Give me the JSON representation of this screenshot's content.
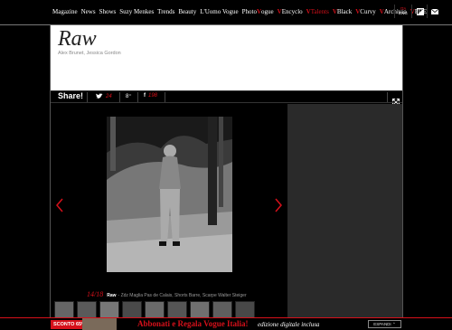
{
  "nav": {
    "items": [
      {
        "text": "Magazine",
        "prefix": ""
      },
      {
        "text": "News",
        "prefix": ""
      },
      {
        "text": "Shows",
        "prefix": ""
      },
      {
        "text": "Suzy Menkes",
        "prefix": ""
      },
      {
        "text": "Trends",
        "prefix": ""
      },
      {
        "text": "Beauty",
        "prefix": ""
      },
      {
        "text": "L'Uomo Vogue",
        "prefix": ""
      },
      {
        "text": "Photo",
        "prefix": "",
        "suffix": "ogue"
      },
      {
        "text": "Encyclo",
        "prefix": "V"
      },
      {
        "text": "Talents",
        "prefix": "V"
      },
      {
        "text": "Black",
        "prefix": "V"
      },
      {
        "text": "Curvy",
        "prefix": "V"
      },
      {
        "text": "Archivio",
        "prefix": "V"
      },
      {
        "text": "FDE",
        "prefix": "V"
      }
    ],
    "lang_active": "ITA",
    "lang_other": "ENG",
    "icons": [
      "contrast-icon",
      "mail-icon"
    ]
  },
  "header": {
    "title": "Raw",
    "credits": "Alex Brunet, Jessica Gordon"
  },
  "share": {
    "label": "Share!",
    "twitter_count": "24",
    "gplus_label": "8⁺",
    "facebook_count": "198"
  },
  "gallery": {
    "counter": "14/18",
    "caption_title": "Raw",
    "caption_text": "- Zdz Maglia Pas de Calais, Shorts Barre, Scarpe Walter Steiger",
    "thumb_count": 9
  },
  "banner": {
    "badge": "SCONTO 65%",
    "main": "Abbonati e Regala Vogue Italia!",
    "sub": "edizione digitale inclusa",
    "button": "ESPANDI"
  },
  "colors": {
    "accent": "#d6101a",
    "background": "#000000",
    "title_box": "#ffffff"
  }
}
